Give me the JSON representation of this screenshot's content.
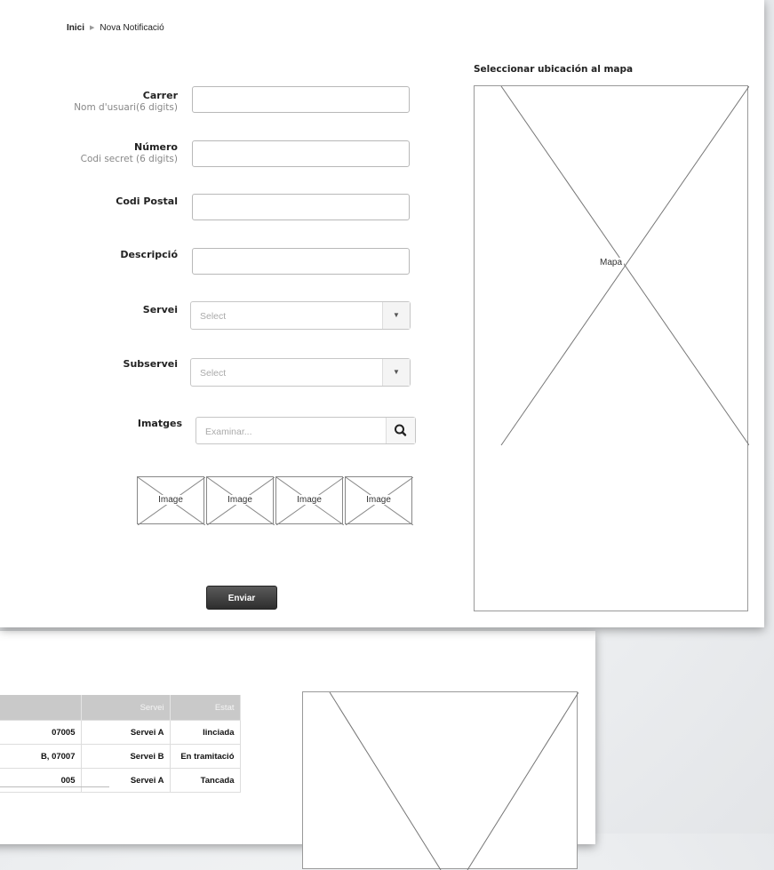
{
  "breadcrumb": {
    "home": "Inici",
    "separator": "▶",
    "current": "Nova Notificació"
  },
  "form": {
    "street_label": "Carrer",
    "street_sub": "Nom d'usuari(6 digits)",
    "number_label": "Número",
    "number_sub": "Codi secret (6 digits)",
    "postal_label": "Codi Postal",
    "description_label": "Descripció",
    "service_label": "Servei",
    "service_value": "Select",
    "subservice_label": "Subservei",
    "subservice_value": "Select",
    "images_label": "Imatges",
    "images_placeholder": "Examinar...",
    "thumbnails": [
      "Image",
      "Image",
      "Image",
      "Image"
    ],
    "submit_label": "Enviar"
  },
  "map": {
    "title": "Seleccionar ubicación al mapa",
    "label": "Mapa"
  },
  "list": {
    "headers": [
      "",
      "Servei",
      "Estat"
    ],
    "rows": [
      {
        "address": "07005",
        "service": "Servei A",
        "status": "Iinciada"
      },
      {
        "address": "B, 07007",
        "service": "Servei B",
        "status": "En tramitació"
      },
      {
        "address": "005",
        "service": "Servei A",
        "status": "Tancada"
      }
    ]
  },
  "colors": {
    "button": "#3a3a3a",
    "table_header": "#c9c9c9",
    "border": "#b8b8b8"
  }
}
